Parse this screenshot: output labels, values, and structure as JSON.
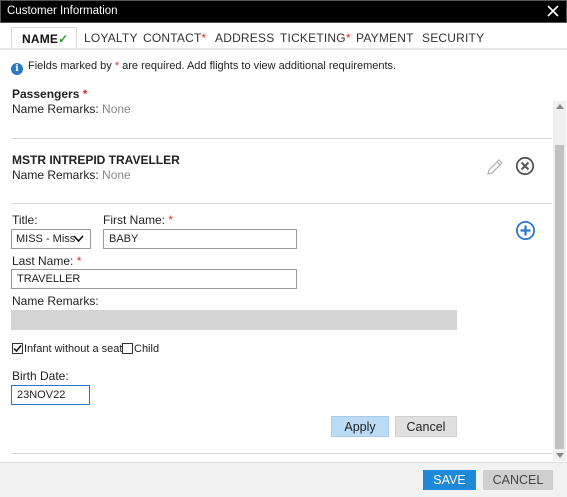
{
  "window": {
    "title": "Customer Information"
  },
  "tabs": [
    {
      "label": "NAME",
      "done_mark": "✓"
    },
    {
      "label": "LOYALTY"
    },
    {
      "label": "CONTACT",
      "required": "*"
    },
    {
      "label": "ADDRESS"
    },
    {
      "label": "TICKETING",
      "required": "*"
    },
    {
      "label": "PAYMENT"
    },
    {
      "label": "SECURITY"
    }
  ],
  "info": {
    "prefix": "Fields marked by ",
    "star": "*",
    "suffix": " are required. Add flights to view additional requirements.",
    "icon": "info-icon"
  },
  "passengers": {
    "title": "Passengers",
    "star": "*",
    "partial_row": {
      "remarks_label": "Name Remarks:",
      "remarks_value": "None"
    },
    "passenger": {
      "name": "MSTR INTREPID TRAVELLER",
      "remarks_label": "Name Remarks:",
      "remarks_value": "None",
      "edit_icon": "pencil-icon",
      "remove_icon": "close-circle-icon"
    }
  },
  "form": {
    "title_label": "Title:",
    "title_value": "MISS - Miss",
    "first_name_label": "First Name:",
    "first_name_value": "BABY",
    "last_name_label": "Last Name:",
    "last_name_value": "TRAVELLER",
    "remarks_label": "Name Remarks:",
    "remarks_value": "",
    "infant_label": "Infant without a seat",
    "infant_checked": true,
    "child_label": "Child",
    "child_checked": false,
    "birth_label": "Birth Date:",
    "birth_value": "23NOV22",
    "required_mark": "*",
    "apply_label": "Apply",
    "cancel_label": "Cancel",
    "add_icon": "plus-circle-icon"
  },
  "footer": {
    "save_label": "SAVE",
    "cancel_label": "CANCEL"
  },
  "colors": {
    "accent": "#2b78c5",
    "required": "#e03030",
    "check": "#2a9a2a",
    "apply_bg": "#bcdcf5",
    "save_bg": "#1e88d9"
  }
}
